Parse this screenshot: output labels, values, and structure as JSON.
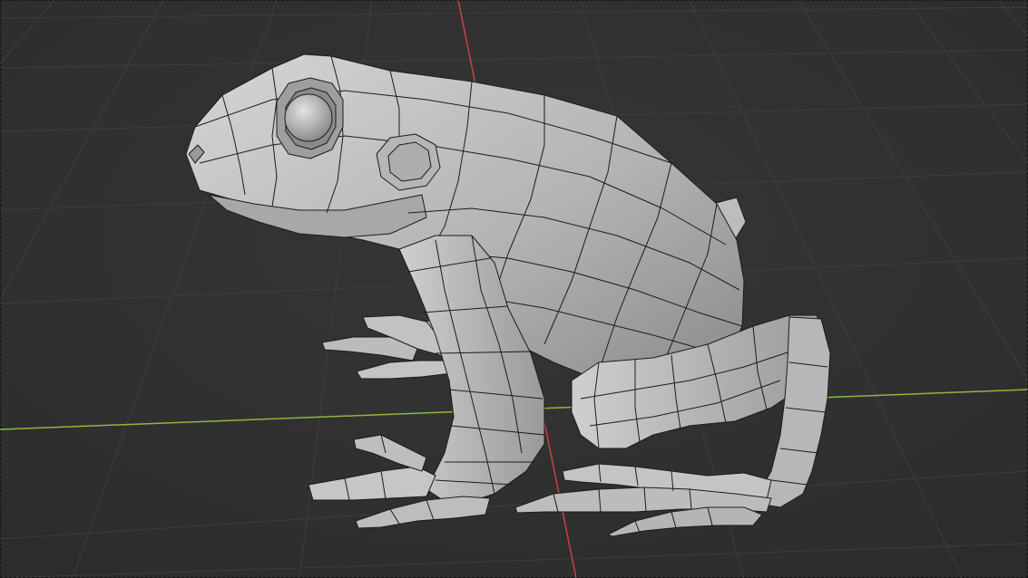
{
  "viewport": {
    "mode": "3d-perspective-viewport",
    "shading": "solid",
    "overlays": [
      "wireframe",
      "floor-grid",
      "x-axis-line",
      "y-axis-line"
    ],
    "object": "frog-mesh",
    "colors": {
      "background": "#303030",
      "grid": "#3d3d3d",
      "x_axis": "#8fb63e",
      "y_axis": "#c8404c",
      "mesh_base": "#b8b8b8",
      "mesh_light": "#d4d4d4",
      "mesh_shadow": "#7a7a7a",
      "wire": "#1a1a1a"
    }
  }
}
